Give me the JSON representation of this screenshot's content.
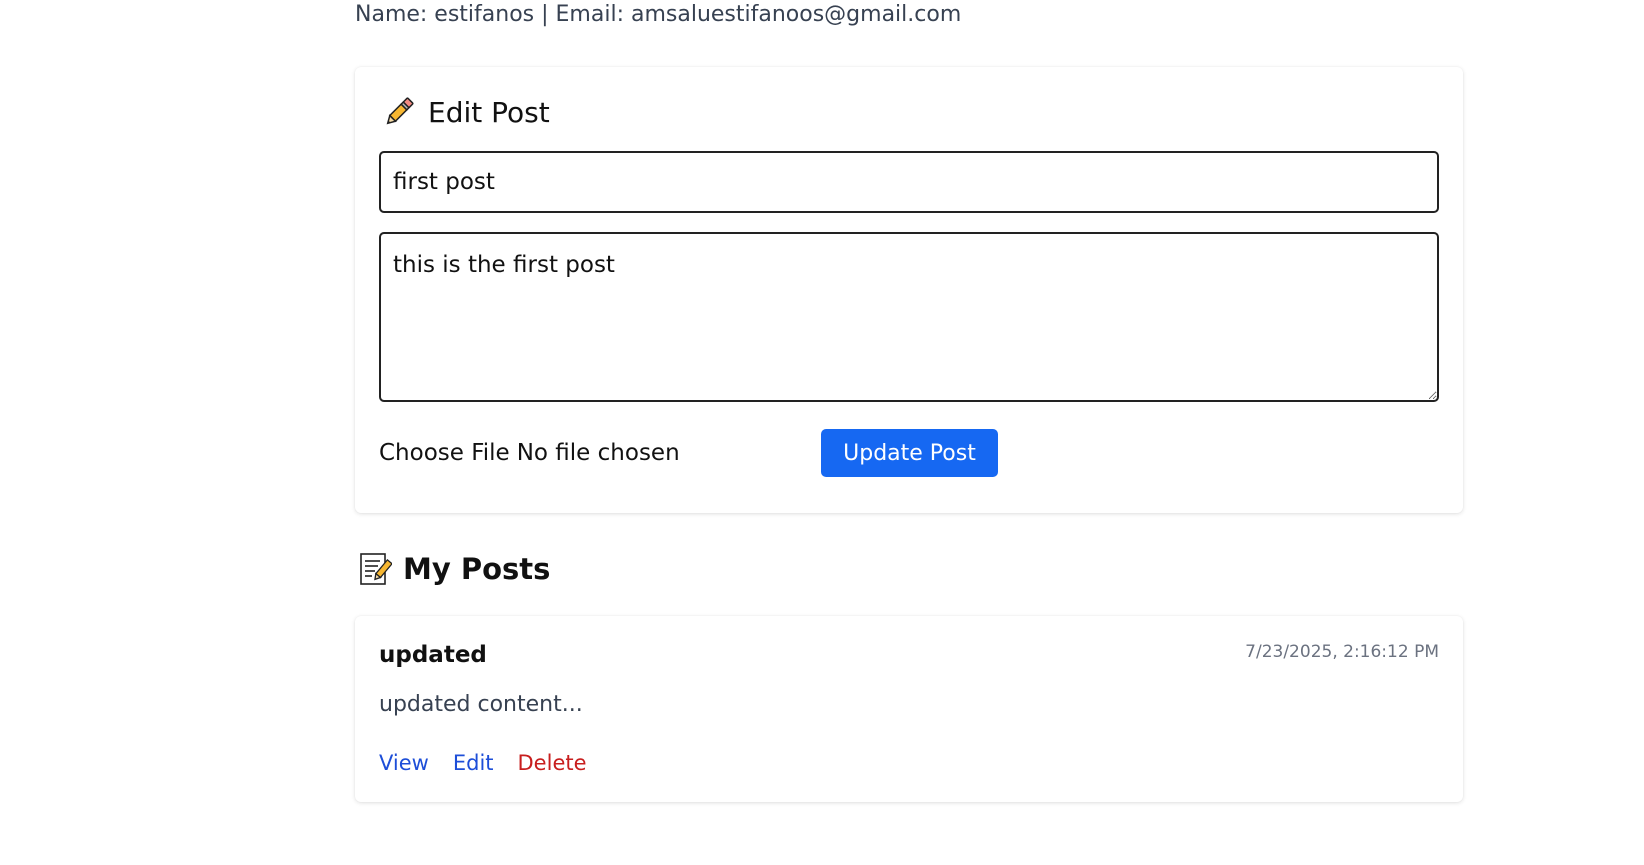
{
  "user": {
    "info": "Name: estifanos | Email: amsaluestifanoos@gmail.com"
  },
  "edit_form": {
    "title": "Edit Post",
    "title_icon": "pencil-icon",
    "title_value": "first post",
    "content_value": "this is the first post",
    "file_button": "Choose File",
    "file_status": "No file chosen",
    "submit_label": "Update Post",
    "accent_color": "#1668f2"
  },
  "my_posts": {
    "heading": "My Posts",
    "heading_icon": "memo-icon",
    "items": [
      {
        "title": "updated",
        "timestamp": "7/23/2025, 2:16:12 PM",
        "excerpt": "updated content...",
        "actions": {
          "view": "View",
          "edit": "Edit",
          "delete": "Delete"
        }
      }
    ]
  }
}
